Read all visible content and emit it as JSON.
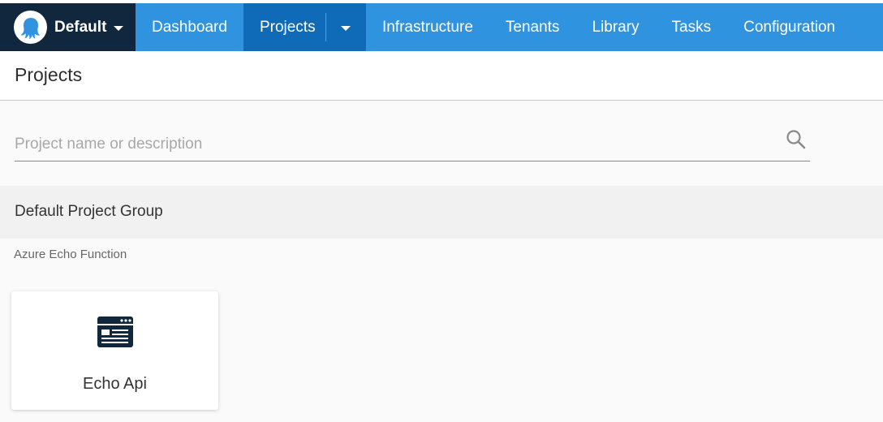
{
  "nav": {
    "space_name": "Default",
    "items": {
      "dashboard": "Dashboard",
      "projects": "Projects",
      "infrastructure": "Infrastructure",
      "tenants": "Tenants",
      "library": "Library",
      "tasks": "Tasks",
      "configuration": "Configuration"
    }
  },
  "page": {
    "title": "Projects"
  },
  "search": {
    "placeholder": "Project name or description",
    "value": ""
  },
  "group": {
    "title": "Default Project Group",
    "description": "Azure Echo Function",
    "projects": [
      {
        "name": "Echo Api",
        "icon": "web-app-icon"
      }
    ]
  },
  "colors": {
    "nav_bg": "#2f93e0",
    "nav_active": "#0f6ab8",
    "space_bg": "#10273e"
  }
}
